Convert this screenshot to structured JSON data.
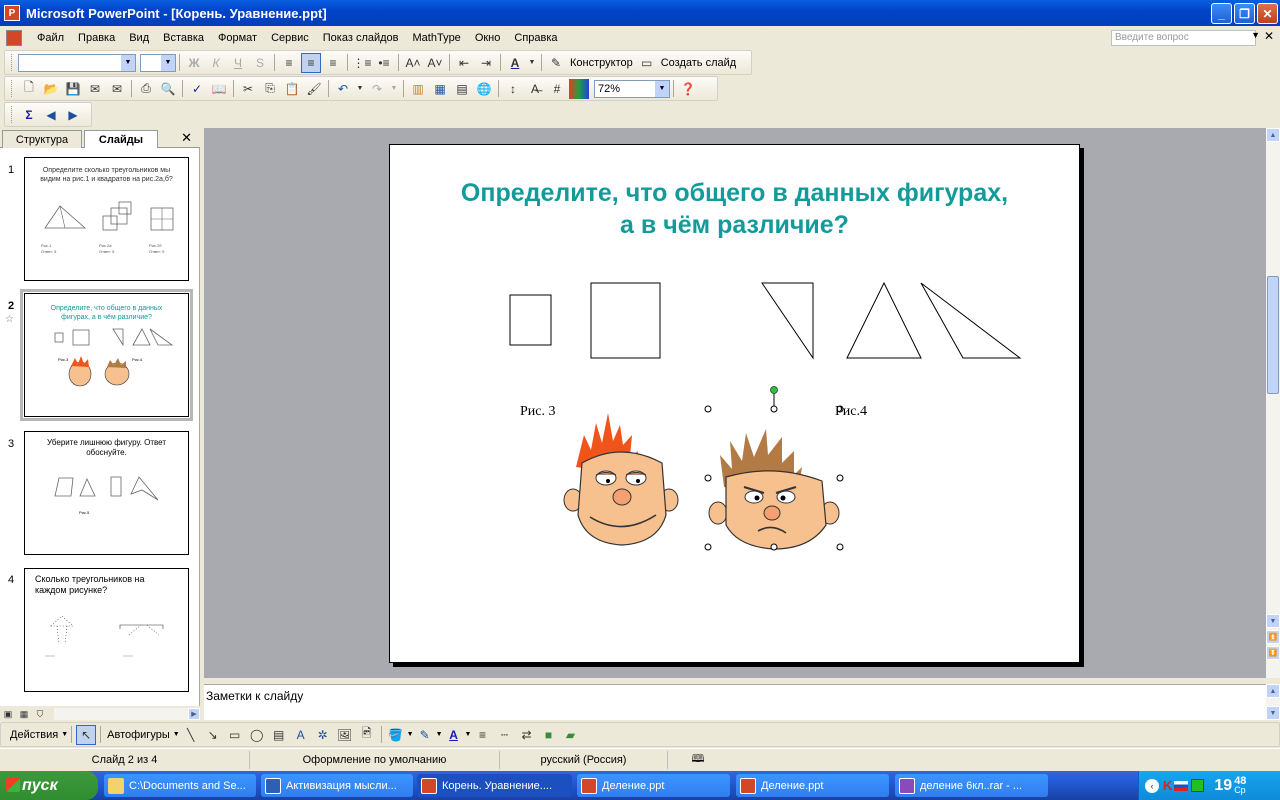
{
  "window": {
    "title": "Microsoft PowerPoint - [Корень. Уравнение.ppt]",
    "app_icon": "P"
  },
  "menu": {
    "items": [
      "Файл",
      "Правка",
      "Вид",
      "Вставка",
      "Формат",
      "Сервис",
      "Показ слайдов",
      "MathType",
      "Окно",
      "Справка"
    ],
    "ask_placeholder": "Введите вопрос"
  },
  "toolbar_format": {
    "designer": "Конструктор",
    "new_slide": "Создать слайд"
  },
  "toolbar_standard": {
    "zoom": "72%"
  },
  "left_pane": {
    "tabs": [
      "Структура",
      "Слайды"
    ],
    "close": "✕",
    "thumbnails": [
      {
        "num": "1",
        "title": "Определите сколько треугольников мы видим на рис.1 и квадратов на рис.2а,б?",
        "labels": [
          "Рис.1",
          "Рис.2а",
          "Рис.2б"
        ],
        "answers": [
          "Ответ: 5",
          "Ответ: 5",
          "Ответ: 9"
        ]
      },
      {
        "num": "2",
        "title": "Определите, что общего в данных фигурах, а в чём различие?",
        "labels": [
          "Рис.3",
          "Рис.4"
        ]
      },
      {
        "num": "3",
        "title": "Уберите лишнюю фигуру. Ответ обоснуйте.",
        "labels": [
          "Рис.5"
        ]
      },
      {
        "num": "4",
        "title": "Сколько треугольников на каждом рисунке?"
      }
    ]
  },
  "slide": {
    "title_line1": "Определите, что общего в данных фигурах,",
    "title_line2": "а в чём различие?",
    "caption_left": "Рис. 3",
    "caption_right": "Рис.4",
    "title_color": "#139a9a"
  },
  "notes": {
    "text": "Заметки к слайду"
  },
  "drawbar": {
    "actions": "Действия",
    "autoshapes": "Автофигуры"
  },
  "status": {
    "slide": "Слайд 2 из 4",
    "design": "Оформление по умолчанию",
    "language": "русский (Россия)"
  },
  "taskbar": {
    "start": "пуск",
    "tasks": [
      "C:\\Documents and Se...",
      "Активизация мысли...",
      "Корень. Уравнение....",
      "Деление.ppt",
      "Деление.ppt",
      "деление 6кл..rar - ..."
    ],
    "clock": "19",
    "clock_min": "48",
    "clock_day": "Ср"
  }
}
